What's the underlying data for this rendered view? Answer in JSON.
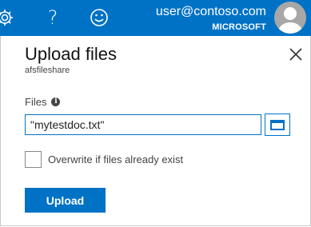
{
  "topbar": {
    "icons": [
      "gear-icon",
      "help-icon",
      "smiley-icon"
    ],
    "help_glyph": "?",
    "user_email": "user@contoso.com",
    "user_org": "MICROSOFT",
    "background_color": "#0072c6"
  },
  "panel": {
    "title": "Upload files",
    "subtitle": "afsfileshare",
    "files_label": "Files",
    "info_glyph": "i",
    "file_value": "\"mytestdoc.txt\"",
    "overwrite_label": "Overwrite if files already exist",
    "overwrite_checked": false,
    "upload_label": "Upload",
    "accent_color": "#0072c6"
  }
}
